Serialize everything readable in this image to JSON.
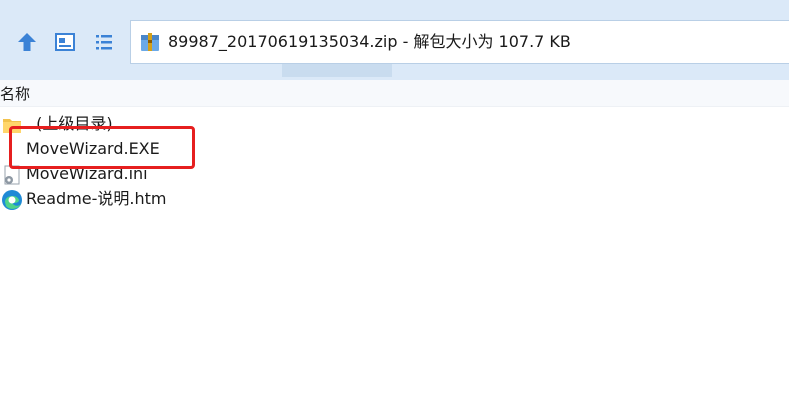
{
  "window": {
    "address_text": "89987_20170619135034.zip - 解包大小为 107.7 KB"
  },
  "toolbar": {
    "up_icon": "up-arrow-icon",
    "view_icon": "view-pane-icon",
    "list_icon": "list-view-icon",
    "archive_icon": "winrar-archive-icon"
  },
  "file_list": {
    "column_name": "名称",
    "items": [
      {
        "name": "..(上级目录)",
        "icon": "folder-icon"
      },
      {
        "name": "MoveWizard.EXE",
        "icon": "none"
      },
      {
        "name": "MoveWizard.ini",
        "icon": "settings-file-icon"
      },
      {
        "name": "Readme-说明.htm",
        "icon": "edge-browser-icon"
      }
    ]
  },
  "annotation": {
    "highlight_color": "#e61f1f",
    "highlighted_item": "MoveWizard.EXE"
  }
}
